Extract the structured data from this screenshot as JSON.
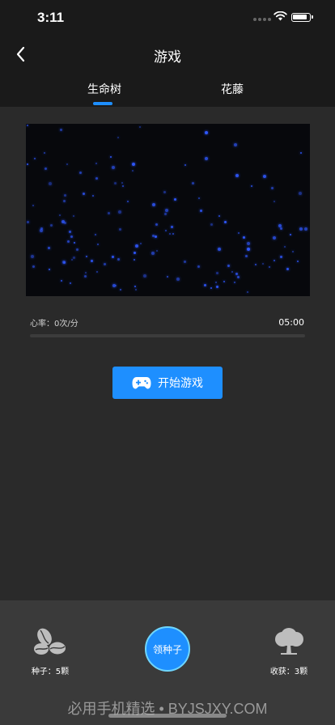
{
  "status_bar": {
    "time": "3:11"
  },
  "nav": {
    "title": "游戏"
  },
  "tabs": [
    {
      "label": "生命树",
      "active": true
    },
    {
      "label": "花藤",
      "active": false
    }
  ],
  "game": {
    "heart_rate": "心率：0次/分",
    "timer": "05:00",
    "progress": 0,
    "start_label": "开始游戏",
    "background_color": "#07080c",
    "star_color": "#2f58ff"
  },
  "bottom": {
    "seeds_label": "种子：5颗",
    "claim_label": "领种子",
    "harvest_label": "收获：3颗"
  },
  "watermark": "必用手机精选 • BYJSJXY.COM",
  "colors": {
    "accent": "#1e8fff",
    "panel": "#3a3a3a",
    "background": "#2a2a2a"
  }
}
